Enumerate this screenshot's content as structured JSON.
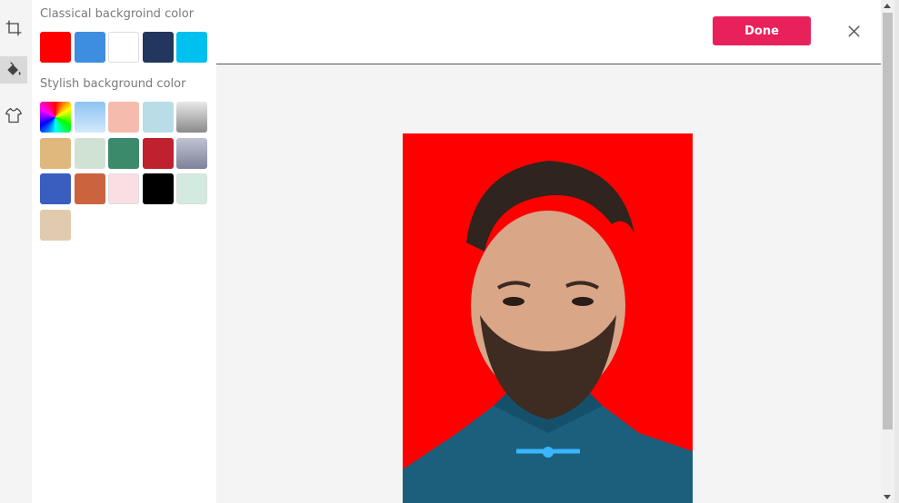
{
  "sidebar": {
    "tools": [
      {
        "icon": "crop-icon",
        "active": false
      },
      {
        "icon": "paint-bucket-icon",
        "active": true
      },
      {
        "icon": "shirt-icon",
        "active": false
      }
    ]
  },
  "panel": {
    "classical_title": "Classical backgroind color",
    "stylish_title": "Stylish background color",
    "classical_colors": [
      "#ff0000",
      "#3d8ee0",
      "#ffffff",
      "#23375e",
      "#00c0f0"
    ],
    "stylish_colors": [
      "rainbow",
      "#a8d4f5",
      "#f5bcae",
      "#b8dde6",
      "#a0a0a0",
      "#e0b87e",
      "#cfe2d4",
      "#3b8a6b",
      "#c0212e",
      "#8e93ab",
      "#3a5ec0",
      "#cc633f",
      "#fbdde4",
      "#000000",
      "#d3eae0",
      "#e0cbae"
    ]
  },
  "header": {
    "done_label": "Done",
    "accent_color": "#e8215a"
  },
  "photo": {
    "background_color": "#ff0000",
    "subject": "man-portrait-photo"
  }
}
